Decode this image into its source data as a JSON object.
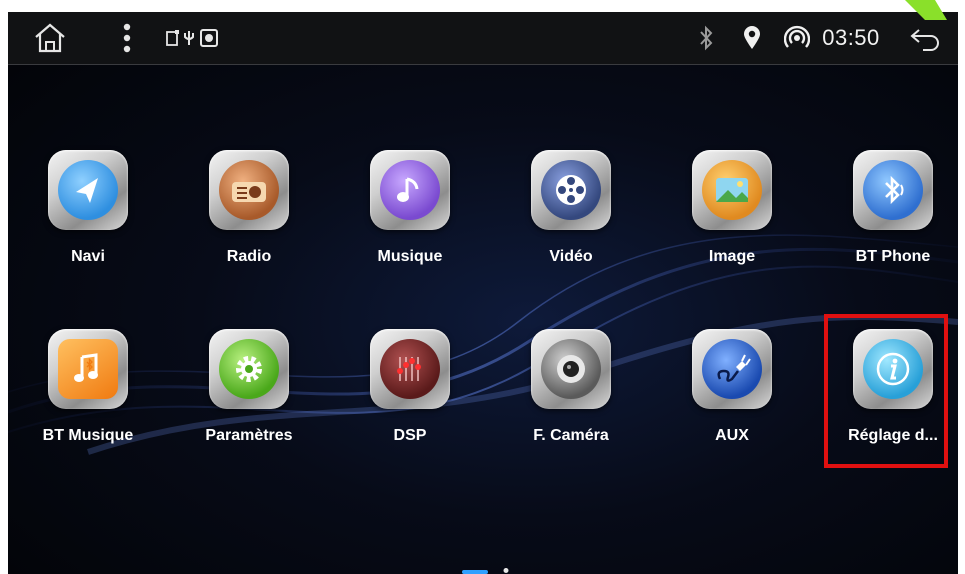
{
  "status_bar": {
    "time": "03:50",
    "icons": [
      "home-icon",
      "menu-dots-icon",
      "notification-icons",
      "bluetooth-icon",
      "location-icon",
      "hotspot-icon",
      "back-icon"
    ]
  },
  "apps": [
    {
      "label": "Navi",
      "icon": "navigation-arrow-icon",
      "color": "#2f8fe0"
    },
    {
      "label": "Radio",
      "icon": "radio-icon",
      "color": "#b06a3a"
    },
    {
      "label": "Musique",
      "icon": "music-note-icon",
      "color": "#8a5cd8"
    },
    {
      "label": "Vidéo",
      "icon": "film-reel-icon",
      "color": "#4a6cc0"
    },
    {
      "label": "Image",
      "icon": "picture-icon",
      "color": "#e0952a"
    },
    {
      "label": "BT Phone",
      "icon": "bluetooth-phone-icon",
      "color": "#2f7fe0"
    },
    {
      "label": "BT Musique",
      "icon": "bluetooth-music-icon",
      "color": "#f08a20"
    },
    {
      "label": "Paramètres",
      "icon": "gear-icon",
      "color": "#5cb82a"
    },
    {
      "label": "DSP",
      "icon": "equalizer-icon",
      "color": "#7a2a2a"
    },
    {
      "label": "F. Caméra",
      "icon": "camera-lens-icon",
      "color": "#6a6a6a"
    },
    {
      "label": "AUX",
      "icon": "aux-cable-icon",
      "color": "#2a6ad8"
    },
    {
      "label": "Réglage d...",
      "icon": "info-icon",
      "color": "#38b0e0"
    }
  ],
  "pager": {
    "pages": 2,
    "current": 1
  }
}
